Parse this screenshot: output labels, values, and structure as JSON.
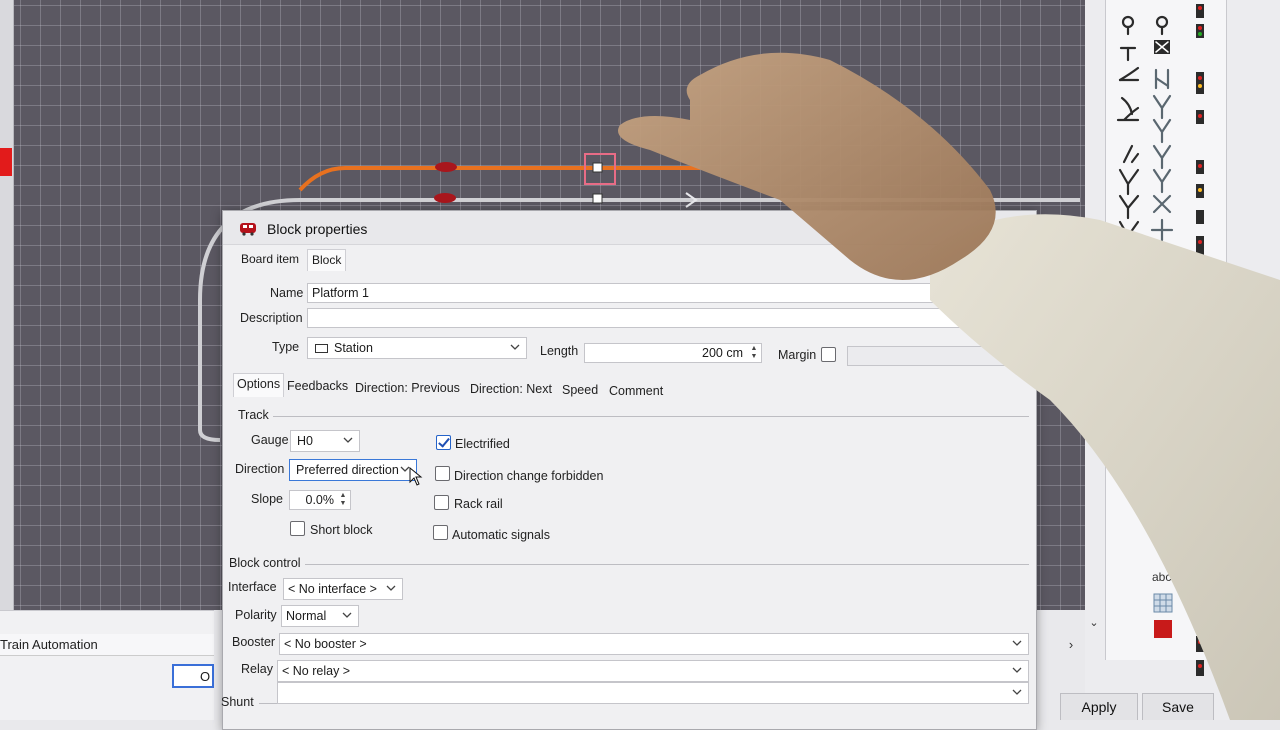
{
  "app": {
    "tab_label": "Train Automation",
    "left_button_label": "O",
    "apply_label": "Apply",
    "save_label": "Save",
    "palette_text_label": "abc"
  },
  "dialog": {
    "title": "Block properties",
    "tabs": [
      "Board item",
      "Block"
    ],
    "name_label": "Name",
    "name_value": "Platform 1",
    "description_label": "Description",
    "description_value": "",
    "type_label": "Type",
    "type_value": "Station",
    "length_label": "Length",
    "length_value": "200 cm",
    "margin_label": "Margin",
    "sub_tabs": [
      "Options",
      "Feedbacks",
      "Direction: Previous",
      "Direction: Next",
      "Speed",
      "Comment"
    ],
    "track": {
      "group_label": "Track",
      "gauge_label": "Gauge",
      "gauge_value": "H0",
      "direction_label": "Direction",
      "direction_value": "Preferred direction",
      "slope_label": "Slope",
      "slope_value": "0.0%",
      "short_block_label": "Short block",
      "short_block_checked": false,
      "electrified_label": "Electrified",
      "electrified_checked": true,
      "direction_change_label": "Direction change forbidden",
      "direction_change_checked": false,
      "rack_rail_label": "Rack rail",
      "rack_rail_checked": false,
      "automatic_signals_label": "Automatic signals",
      "automatic_signals_checked": false
    },
    "block_control": {
      "group_label": "Block control",
      "interface_label": "Interface",
      "interface_value": "< No interface >",
      "polarity_label": "Polarity",
      "polarity_value": "Normal",
      "booster_label": "Booster",
      "booster_value": "< No booster >",
      "relay_label": "Relay",
      "relay_value": "< No relay >"
    },
    "shunt_label": "Shunt"
  },
  "colors": {
    "canvas": "#5b5862",
    "active_track": "#e8711f",
    "inactive_track": "#d0d0d4",
    "block_marker": "#a8161c",
    "accent": "#2563c9"
  }
}
